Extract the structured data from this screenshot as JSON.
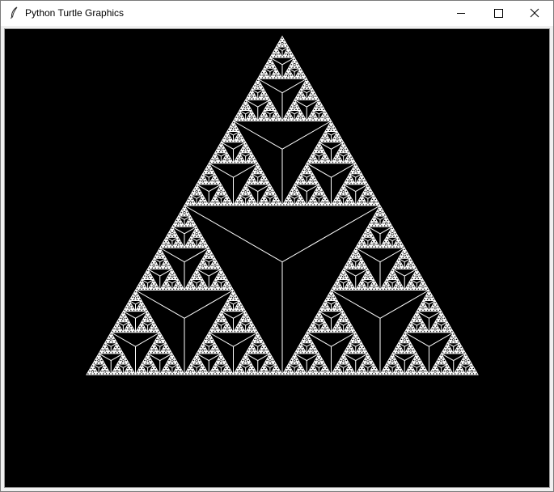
{
  "window": {
    "title": "Python Turtle Graphics",
    "icons": {
      "app": "feather-icon",
      "minimize": "minimize-icon",
      "maximize": "maximize-icon",
      "close": "close-icon"
    }
  },
  "canvas": {
    "background": "#000000",
    "pen_color": "#ffffff",
    "figure": "sierpinski-triangle",
    "recursion_depth": 7
  }
}
